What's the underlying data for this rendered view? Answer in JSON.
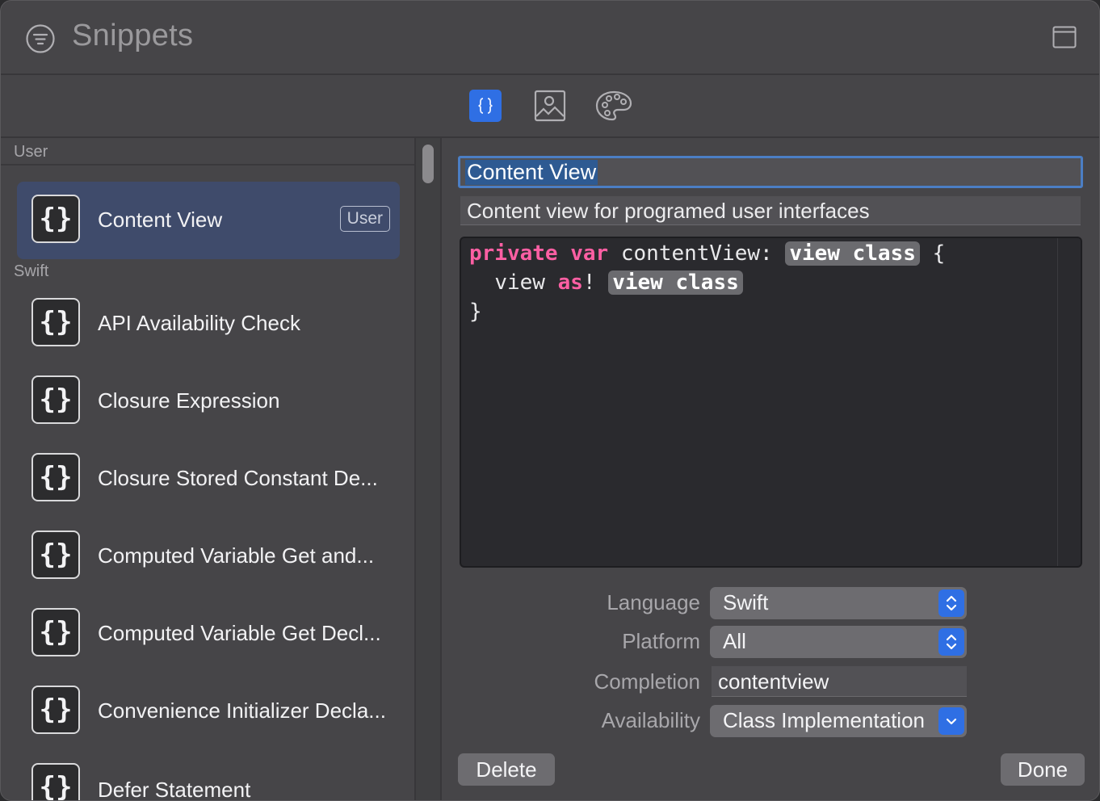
{
  "window": {
    "title": "Snippets"
  },
  "toolbar": {
    "buttons": [
      {
        "icon": "code-snippet-icon",
        "selected": true
      },
      {
        "icon": "image-media-icon",
        "selected": false
      },
      {
        "icon": "color-palette-icon",
        "selected": false
      }
    ]
  },
  "sidebar": {
    "sections": [
      {
        "label": "User"
      },
      {
        "label": "Swift"
      }
    ],
    "user_items": [
      {
        "label": "Content View",
        "badge": "User",
        "selected": true
      }
    ],
    "swift_items": [
      {
        "label": "API Availability Check"
      },
      {
        "label": "Closure Expression"
      },
      {
        "label": "Closure Stored Constant De..."
      },
      {
        "label": "Computed Variable Get and..."
      },
      {
        "label": "Computed Variable Get Decl..."
      },
      {
        "label": "Convenience Initializer Decla..."
      },
      {
        "label": "Defer Statement"
      }
    ]
  },
  "detail": {
    "title": "Content View",
    "description": "Content view for programed user interfaces",
    "code": {
      "line1": {
        "kw1": "private",
        "kw2": "var",
        "text": "contentView:",
        "placeholder": "view class",
        "tail": "{"
      },
      "line2": {
        "text": "view",
        "kw": "as",
        "bang": "!",
        "placeholder": "view class"
      },
      "line3": {
        "text": "}"
      }
    },
    "properties": {
      "language": {
        "label": "Language",
        "value": "Swift"
      },
      "platform": {
        "label": "Platform",
        "value": "All"
      },
      "completion": {
        "label": "Completion",
        "value": "contentview"
      },
      "availability": {
        "label": "Availability",
        "value": "Class Implementation"
      }
    },
    "buttons": {
      "delete": "Delete",
      "done": "Done"
    }
  },
  "colors": {
    "accent": "#2f6fe4",
    "selection": "#3f4b6b",
    "keyword": "#fc5fa3",
    "window_bg": "#464548"
  }
}
